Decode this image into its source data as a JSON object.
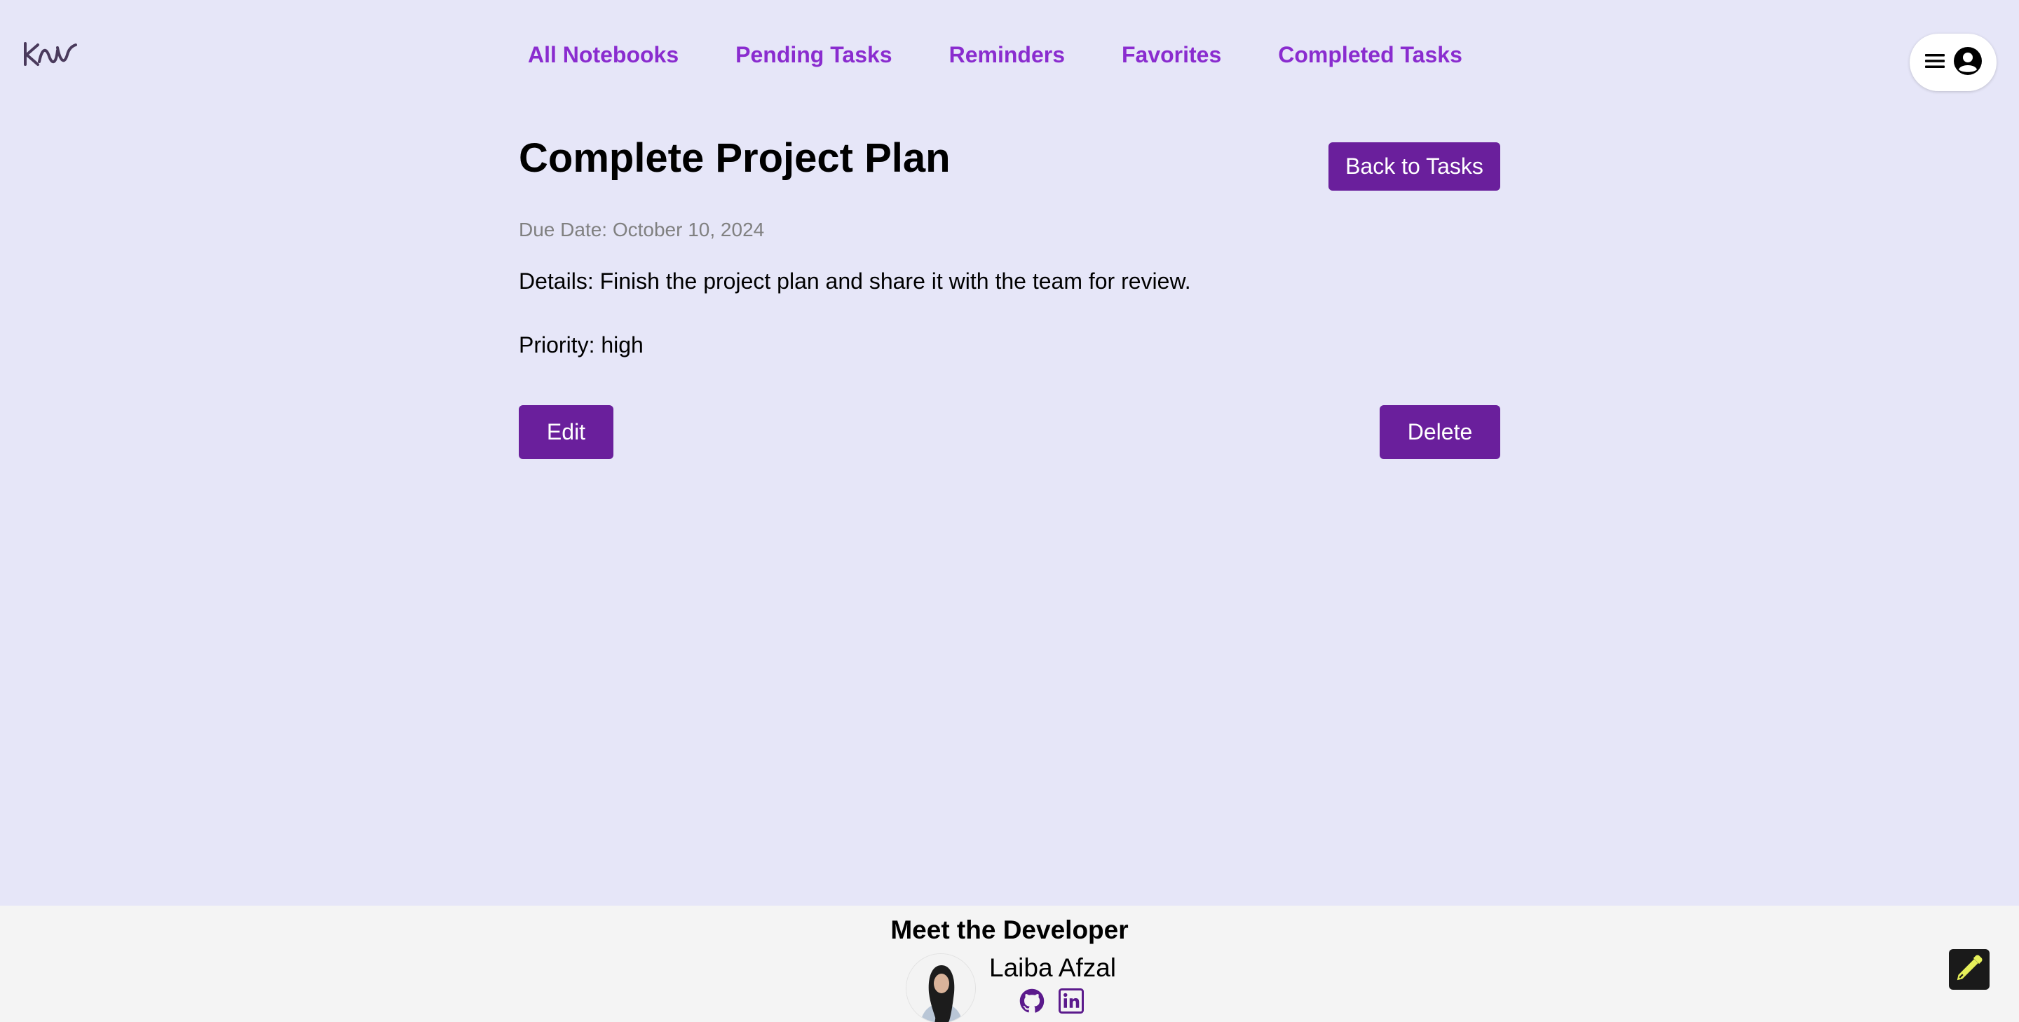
{
  "nav": {
    "items": [
      {
        "label": "All Notebooks"
      },
      {
        "label": "Pending Tasks"
      },
      {
        "label": "Reminders"
      },
      {
        "label": "Favorites"
      },
      {
        "label": "Completed Tasks"
      }
    ],
    "link_color": "#8a2ccf"
  },
  "header": {
    "logo_icon": "knw-logo",
    "menu_icon": "hamburger-icon",
    "profile_icon": "user-circle-icon"
  },
  "task": {
    "title": "Complete Project Plan",
    "back_label": "Back to Tasks",
    "due": "Due Date: October 10, 2024",
    "details": "Details: Finish the project plan and share it with the team for review.",
    "priority": "Priority: high",
    "edit_label": "Edit",
    "delete_label": "Delete"
  },
  "footer": {
    "title": "Meet the Developer",
    "developer_name": "Laiba Afzal",
    "links": [
      "github-icon",
      "linkedin-icon"
    ]
  },
  "floating": {
    "icon": "pen-icon"
  },
  "colors": {
    "background": "#e6e6f8",
    "button": "#6a1f9c",
    "footer_bg": "#f4f4f4",
    "icon_purple": "#5b1a8c"
  }
}
